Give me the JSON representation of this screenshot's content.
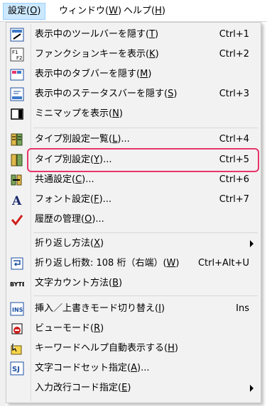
{
  "menubar": {
    "items": [
      {
        "name": "設定",
        "key": "O"
      },
      {
        "name": "ウィンドウ",
        "key": "W"
      },
      {
        "name": "ヘルプ",
        "key": "H"
      }
    ]
  },
  "menu": {
    "items": [
      {
        "text": "表示中のツールバーを隠す",
        "key": "T",
        "shortcut": "Ctrl+1",
        "icon": "toolbar-icon"
      },
      {
        "text": "ファンクションキーを表示",
        "key": "K",
        "shortcut": "Ctrl+2",
        "icon": "function-key-icon"
      },
      {
        "text": "表示中のタブバーを隠す",
        "key": "M",
        "shortcut": "",
        "icon": "tabbar-icon"
      },
      {
        "text": "表示中のステータスバーを隠す",
        "key": "S",
        "shortcut": "Ctrl+3",
        "icon": "statusbar-icon"
      },
      {
        "text": "ミニマップを表示",
        "key": "N",
        "shortcut": "",
        "icon": "minimap-icon"
      },
      {
        "text": "タイプ別設定一覧",
        "key": "L",
        "suffix": "...",
        "shortcut": "Ctrl+4",
        "icon": "type-list-icon"
      },
      {
        "text": "タイプ別設定",
        "key": "Y",
        "suffix": "...",
        "shortcut": "Ctrl+5",
        "icon": "",
        "highlighted": true
      },
      {
        "text": "共通設定",
        "key": "C",
        "suffix": "...",
        "shortcut": "Ctrl+6",
        "icon": "common-settings-icon"
      },
      {
        "text": "フォント設定",
        "key": "F",
        "suffix": "...",
        "shortcut": "Ctrl+7",
        "icon": "font-icon"
      },
      {
        "text": "履歴の管理",
        "key": "O",
        "suffix": "...",
        "shortcut": "",
        "icon": "checkmark-icon"
      },
      {
        "text": "折り返し方法",
        "key": "X",
        "shortcut": "",
        "icon": "",
        "submenu": true
      },
      {
        "text": "折り返し桁数: 108 桁（右端）",
        "key": "W",
        "shortcut": "Ctrl+Alt+U",
        "icon": "wrap-icon"
      },
      {
        "text": "文字カウント方法",
        "key": "B",
        "shortcut": "",
        "icon": "byte-icon"
      },
      {
        "text": "挿入／上書きモード切り替え",
        "key": "I",
        "shortcut": "Ins",
        "icon": "insert-mode-icon"
      },
      {
        "text": "ビューモード",
        "key": "R",
        "shortcut": "",
        "icon": "view-mode-icon"
      },
      {
        "text": "キーワードヘルプ自動表示する",
        "key": "H",
        "shortcut": "",
        "icon": "keyword-help-icon"
      },
      {
        "text": "文字コードセット指定",
        "key": "A",
        "suffix": "...",
        "shortcut": "",
        "icon": "charset-icon"
      },
      {
        "text": "入力改行コード指定",
        "key": "E",
        "shortcut": "",
        "icon": "",
        "submenu": true
      }
    ]
  },
  "colors": {
    "menu_bg": "#f2f2f2",
    "active_menubar": "#cce8ff",
    "highlight_border": "#e8356b"
  }
}
